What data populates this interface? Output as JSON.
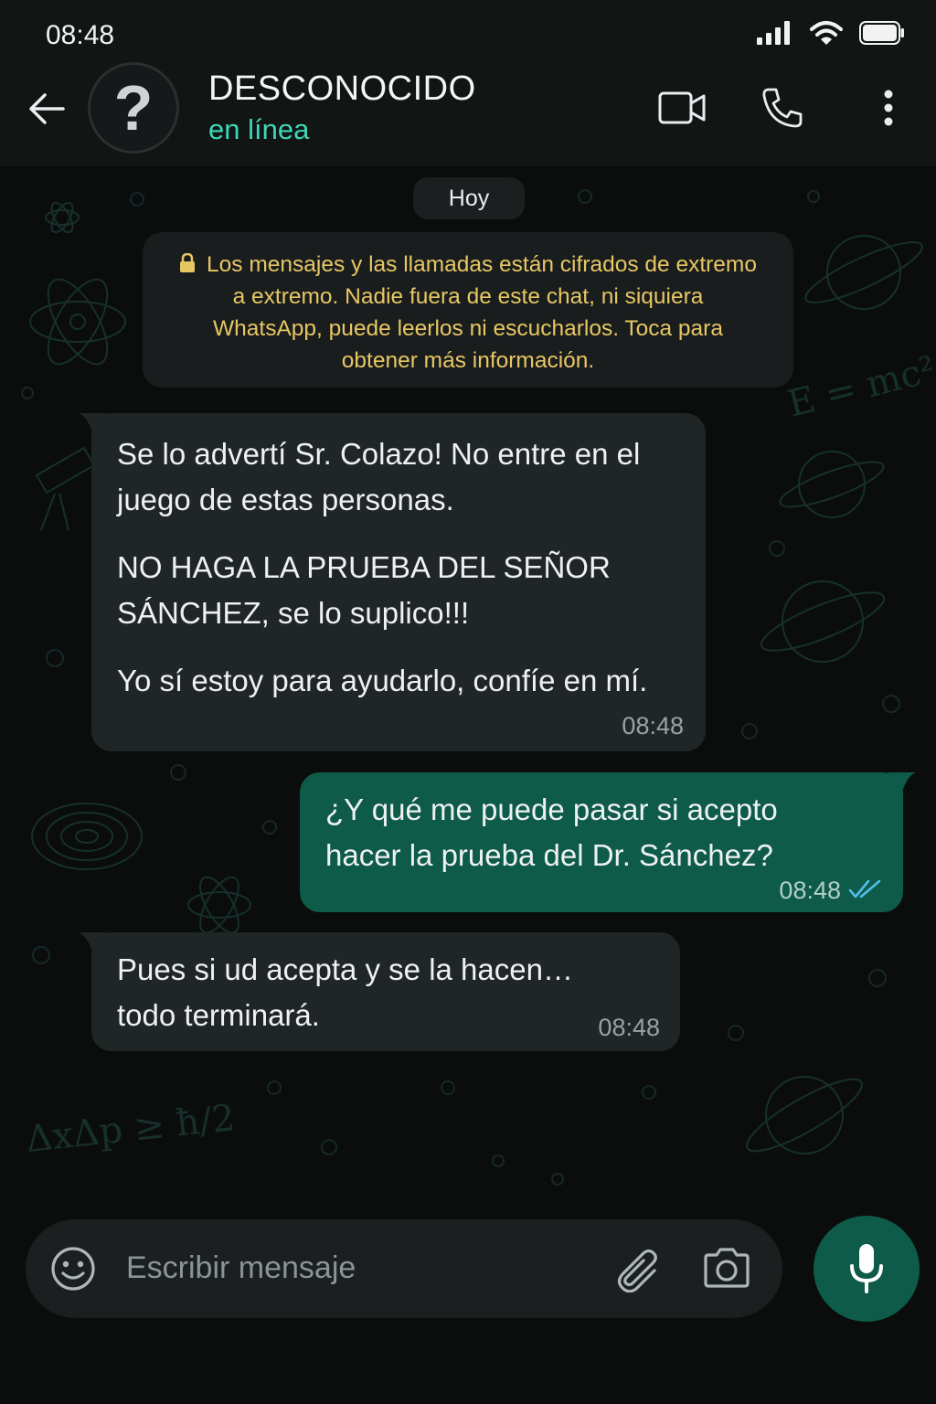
{
  "status_bar": {
    "time": "08:48"
  },
  "header": {
    "contact_name": "DESCONOCIDO",
    "contact_status": "en línea",
    "avatar_glyph": "?"
  },
  "chat": {
    "day_label": "Hoy",
    "encryption_notice": "Los mensajes y las llamadas están cifrados de extremo a extremo. Nadie fuera de este chat, ni siquiera WhatsApp, puede leerlos ni escucharlos. Toca para obtener más información.",
    "messages": [
      {
        "direction": "incoming",
        "paragraphs": [
          "Se lo advertí Sr. Colazo! No entre en el juego de estas personas.",
          "NO HAGA LA PRUEBA DEL SEÑOR SÁNCHEZ, se lo suplico!!!",
          "Yo sí estoy para ayudarlo, confíe en mí."
        ],
        "time": "08:48"
      },
      {
        "direction": "outgoing",
        "paragraphs": [
          "¿Y qué me puede pasar si acepto hacer la prueba del Dr. Sánchez?"
        ],
        "time": "08:48",
        "status": "read"
      },
      {
        "direction": "incoming",
        "paragraphs": [
          "Pues si ud acepta y se la hacen… todo terminará."
        ],
        "time": "08:48"
      }
    ]
  },
  "composer": {
    "placeholder": "Escribir mensaje"
  },
  "colors": {
    "accent": "#3fd6b8",
    "outgoing_bubble": "#0d5b48",
    "incoming_bubble": "#202526",
    "notice_text": "#e7c764",
    "read_ticks": "#53bdeb"
  },
  "icons": {
    "back": "arrow-left-icon",
    "video": "video-camera-icon",
    "call": "phone-icon",
    "menu": "more-vertical-icon",
    "lock": "lock-icon",
    "emoji": "emoji-icon",
    "attach": "paperclip-icon",
    "camera": "camera-icon",
    "mic": "microphone-icon"
  }
}
